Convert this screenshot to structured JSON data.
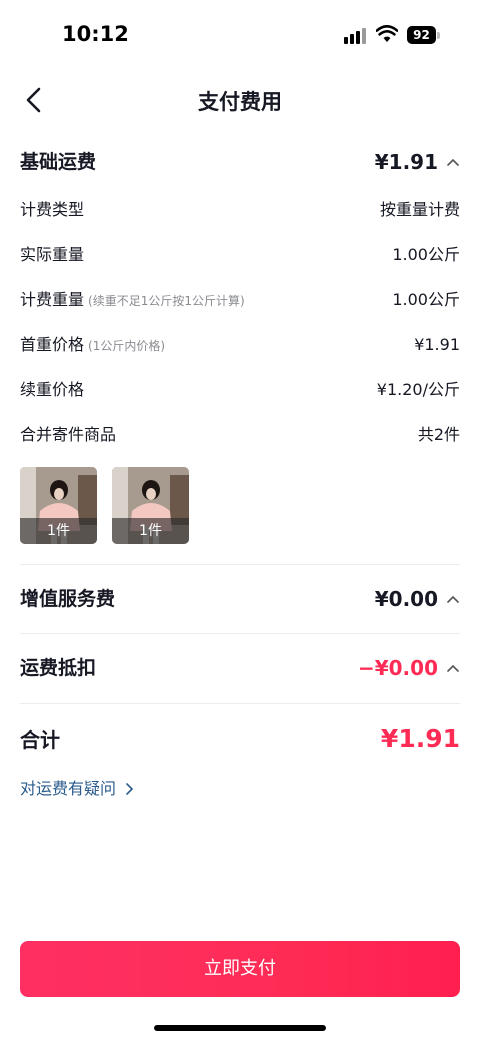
{
  "status_bar": {
    "time": "10:12",
    "battery": "92"
  },
  "header": {
    "title": "支付费用"
  },
  "base_freight": {
    "label": "基础运费",
    "amount": "¥1.91",
    "rows": [
      {
        "label": "计费类型",
        "hint": "",
        "value": "按重量计费"
      },
      {
        "label": "实际重量",
        "hint": "",
        "value": "1.00公斤"
      },
      {
        "label": "计费重量",
        "hint": "(续重不足1公斤按1公斤计算)",
        "value": "1.00公斤"
      },
      {
        "label": "首重价格",
        "hint": "(1公斤内价格)",
        "value": "¥1.91"
      },
      {
        "label": "续重价格",
        "hint": "",
        "value": "¥1.20/公斤"
      },
      {
        "label": "合并寄件商品",
        "hint": "",
        "value": "共2件"
      }
    ],
    "items": [
      {
        "qty": "1件"
      },
      {
        "qty": "1件"
      }
    ]
  },
  "value_added": {
    "label": "增值服务费",
    "amount": "¥0.00"
  },
  "deduction": {
    "label": "运费抵扣",
    "amount": "−¥0.00"
  },
  "total": {
    "label": "合计",
    "amount": "¥1.91"
  },
  "help": {
    "label": "对运费有疑问"
  },
  "pay_button": {
    "label": "立即支付"
  },
  "colors": {
    "accent": "#fe2c55",
    "link": "#2a5b8c",
    "text": "#161823",
    "muted": "#8a8b91"
  },
  "icons": [
    "back-icon",
    "caret-up-icon",
    "chevron-right-icon",
    "signal-icon",
    "wifi-icon",
    "battery-icon"
  ]
}
